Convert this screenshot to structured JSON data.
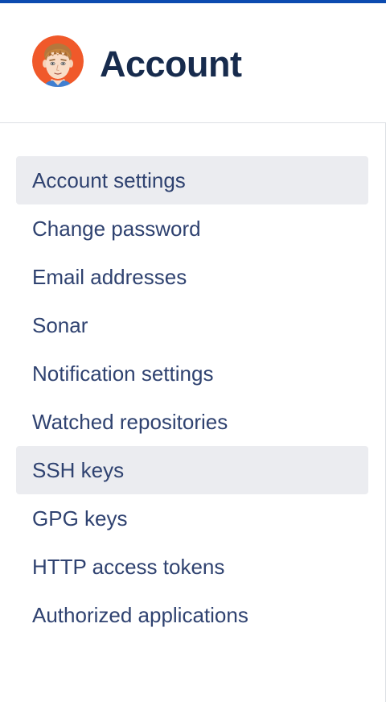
{
  "header": {
    "title": "Account",
    "avatar_icon": "user-avatar-icon"
  },
  "sidebar": {
    "items": [
      {
        "label": "Account settings",
        "active": true
      },
      {
        "label": "Change password",
        "active": false
      },
      {
        "label": "Email addresses",
        "active": false
      },
      {
        "label": "Sonar",
        "active": false
      },
      {
        "label": "Notification settings",
        "active": false
      },
      {
        "label": "Watched repositories",
        "active": false
      },
      {
        "label": "SSH keys",
        "active": true
      },
      {
        "label": "GPG keys",
        "active": false
      },
      {
        "label": "HTTP access tokens",
        "active": false
      },
      {
        "label": "Authorized applications",
        "active": false
      }
    ]
  },
  "colors": {
    "top_bar": "#0c4bb0",
    "title_text": "#172b4d",
    "nav_text": "#2f4270",
    "nav_active_bg": "#ebecf0",
    "avatar_bg": "#f0592a"
  }
}
